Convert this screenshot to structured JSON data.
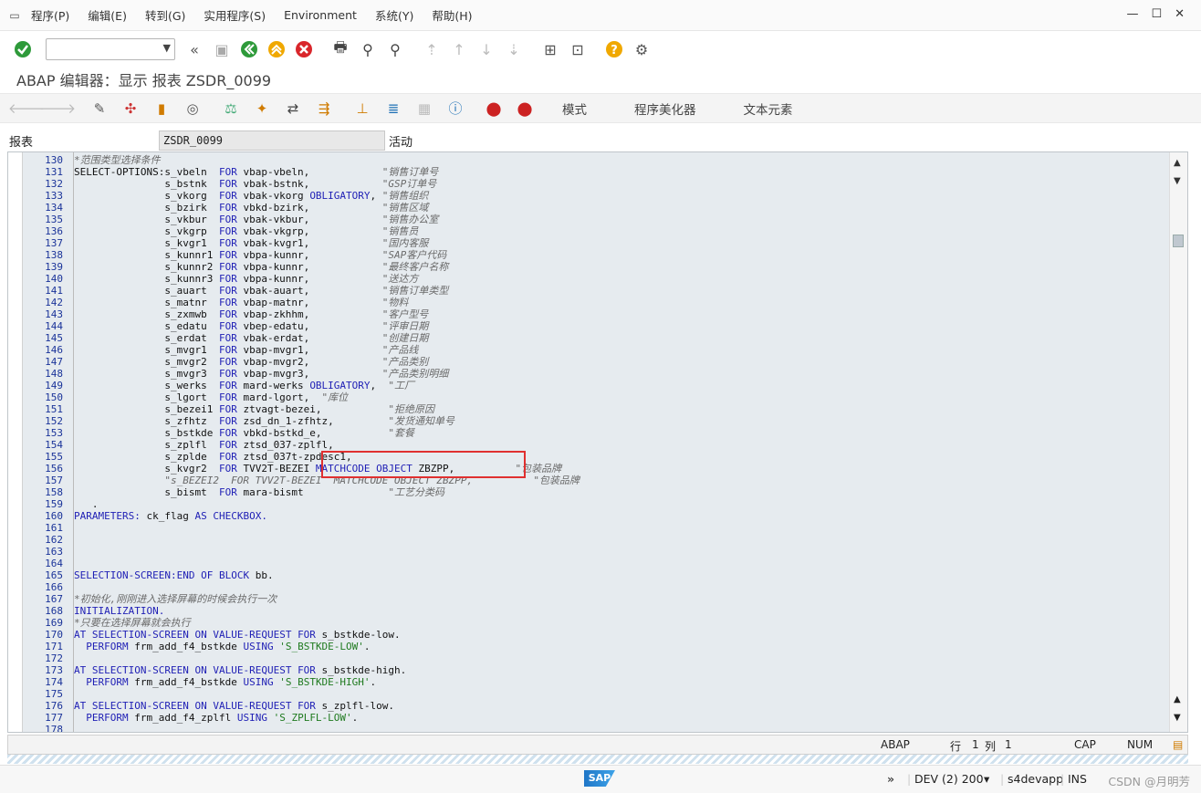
{
  "menubar": {
    "items": [
      "程序(P)",
      "编辑(E)",
      "转到(G)",
      "实用程序(S)",
      "Environment",
      "系统(Y)",
      "帮助(H)"
    ]
  },
  "title": "ABAP 编辑器：显示 报表 ZSDR_0099",
  "app_toolbar": {
    "text_buttons": [
      "模式",
      "程序美化器",
      "文本元素"
    ]
  },
  "report": {
    "label": "报表",
    "value": "ZSDR_0099",
    "status": "活动"
  },
  "code": [
    {
      "n": "130",
      "t": "*范围类型选择条件"
    },
    {
      "n": "131",
      "t": "SELECT-OPTIONS:s_vbeln  FOR vbap-vbeln,            \"销售订单号"
    },
    {
      "n": "132",
      "t": "               s_bstnk  FOR vbak-bstnk,            \"GSP订单号"
    },
    {
      "n": "133",
      "t": "               s_vkorg  FOR vbak-vkorg OBLIGATORY, \"销售组织"
    },
    {
      "n": "134",
      "t": "               s_bzirk  FOR vbkd-bzirk,            \"销售区域"
    },
    {
      "n": "135",
      "t": "               s_vkbur  FOR vbak-vkbur,            \"销售办公室"
    },
    {
      "n": "136",
      "t": "               s_vkgrp  FOR vbak-vkgrp,            \"销售员"
    },
    {
      "n": "137",
      "t": "               s_kvgr1  FOR vbak-kvgr1,            \"国内客服"
    },
    {
      "n": "138",
      "t": "               s_kunnr1 FOR vbpa-kunnr,            \"SAP客户代码"
    },
    {
      "n": "139",
      "t": "               s_kunnr2 FOR vbpa-kunnr,            \"最终客户名称"
    },
    {
      "n": "140",
      "t": "               s_kunnr3 FOR vbpa-kunnr,            \"送达方"
    },
    {
      "n": "141",
      "t": "               s_auart  FOR vbak-auart,            \"销售订单类型"
    },
    {
      "n": "142",
      "t": "               s_matnr  FOR vbap-matnr,            \"物料"
    },
    {
      "n": "143",
      "t": "               s_zxmwb  FOR vbap-zkhhm,            \"客户型号"
    },
    {
      "n": "144",
      "t": "               s_edatu  FOR vbep-edatu,            \"评审日期"
    },
    {
      "n": "145",
      "t": "               s_erdat  FOR vbak-erdat,            \"创建日期"
    },
    {
      "n": "146",
      "t": "               s_mvgr1  FOR vbap-mvgr1,            \"产品线"
    },
    {
      "n": "147",
      "t": "               s_mvgr2  FOR vbap-mvgr2,            \"产品类别"
    },
    {
      "n": "148",
      "t": "               s_mvgr3  FOR vbap-mvgr3,            \"产品类别明细"
    },
    {
      "n": "149",
      "t": "               s_werks  FOR mard-werks OBLIGATORY,  \"工厂"
    },
    {
      "n": "150",
      "t": "               s_lgort  FOR mard-lgort,  \"库位"
    },
    {
      "n": "151",
      "t": "               s_bezei1 FOR ztvagt-bezei,           \"拒绝原因"
    },
    {
      "n": "152",
      "t": "               s_zfhtz  FOR zsd_dn_1-zfhtz,         \"发货通知单号"
    },
    {
      "n": "153",
      "t": "               s_bstkde FOR vbkd-bstkd_e,           \"套餐"
    },
    {
      "n": "154",
      "t": "               s_zplfl  FOR ztsd_037-zplfl,"
    },
    {
      "n": "155",
      "t": "               s_zplde  FOR ztsd_037t-zpdesc1,"
    },
    {
      "n": "156",
      "t": "               s_kvgr2  FOR TVV2T-BEZEI MATCHCODE OBJECT ZBZPP,          \"包装品牌"
    },
    {
      "n": "157",
      "t": "               \"s_BEZEI2  FOR TVV2T-BEZEI  MATCHCODE OBJECT ZBZPP,          \"包装品牌"
    },
    {
      "n": "158",
      "t": "               s_bismt  FOR mara-bismt              \"工艺分类码"
    },
    {
      "n": "159",
      "t": "   ."
    },
    {
      "n": "160",
      "t": "PARAMETERS: ck_flag AS CHECKBOX."
    },
    {
      "n": "161",
      "t": ""
    },
    {
      "n": "162",
      "t": ""
    },
    {
      "n": "163",
      "t": ""
    },
    {
      "n": "164",
      "t": ""
    },
    {
      "n": "165",
      "t": "SELECTION-SCREEN:END OF BLOCK bb."
    },
    {
      "n": "166",
      "t": ""
    },
    {
      "n": "167",
      "t": "*初始化,刚刚进入选择屏幕的时候会执行一次"
    },
    {
      "n": "168",
      "t": "INITIALIZATION."
    },
    {
      "n": "169",
      "t": "*只要在选择屏幕就会执行"
    },
    {
      "n": "170",
      "t": "AT SELECTION-SCREEN ON VALUE-REQUEST FOR s_bstkde-low."
    },
    {
      "n": "171",
      "t": "  PERFORM frm_add_f4_bstkde USING 'S_BSTKDE-LOW'."
    },
    {
      "n": "172",
      "t": ""
    },
    {
      "n": "173",
      "t": "AT SELECTION-SCREEN ON VALUE-REQUEST FOR s_bstkde-high."
    },
    {
      "n": "174",
      "t": "  PERFORM frm_add_f4_bstkde USING 'S_BSTKDE-HIGH'."
    },
    {
      "n": "175",
      "t": ""
    },
    {
      "n": "176",
      "t": "AT SELECTION-SCREEN ON VALUE-REQUEST FOR s_zplfl-low."
    },
    {
      "n": "177",
      "t": "  PERFORM frm_add_f4_zplfl USING 'S_ZPLFL-LOW'."
    },
    {
      "n": "178",
      "t": ""
    }
  ],
  "editor_status": {
    "language": "ABAP",
    "row_label": "行",
    "row_value": "1",
    "col_label": "列",
    "col_value": "1",
    "cap": "CAP",
    "num": "NUM"
  },
  "bottombar": {
    "system": "DEV (2) 200",
    "server": "s4devapp",
    "mode": "INS",
    "watermark": "CSDN @月明芳"
  },
  "icons": {
    "enter": "check-icon",
    "save": "save-icon",
    "back": "back-icon",
    "exit": "exit-icon",
    "cancel": "cancel-icon",
    "help": "help-icon"
  }
}
